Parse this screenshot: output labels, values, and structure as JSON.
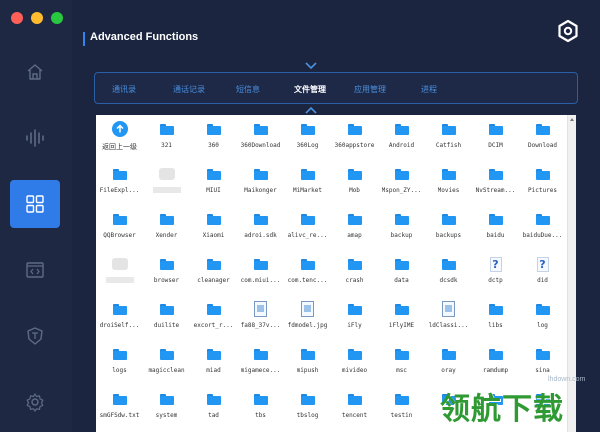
{
  "window": {
    "traffic_lights": [
      {
        "name": "close",
        "color": "#fe5f57"
      },
      {
        "name": "minimize",
        "color": "#febc2e"
      },
      {
        "name": "maximize",
        "color": "#28c840"
      }
    ]
  },
  "sidebar": {
    "items": [
      {
        "id": "home",
        "icon": "home-icon",
        "active": false
      },
      {
        "id": "audio",
        "icon": "audio-wave-icon",
        "active": false
      },
      {
        "id": "apps",
        "icon": "grid-icon",
        "active": true
      },
      {
        "id": "code",
        "icon": "code-window-icon",
        "active": false
      },
      {
        "id": "toolkit",
        "icon": "shield-t-icon",
        "active": false
      },
      {
        "id": "settings",
        "icon": "gear-icon",
        "active": false
      }
    ]
  },
  "header": {
    "title": "Advanced Functions"
  },
  "tabs": [
    {
      "label": "通讯录",
      "active": false
    },
    {
      "label": "通话记录",
      "active": false
    },
    {
      "label": "短信息",
      "active": false
    },
    {
      "label": "文件管理",
      "active": true
    },
    {
      "label": "应用管理",
      "active": false
    },
    {
      "label": "进程",
      "active": false
    }
  ],
  "files": [
    {
      "name": "返回上一级",
      "kind": "back"
    },
    {
      "name": "321",
      "kind": "folder"
    },
    {
      "name": "360",
      "kind": "folder"
    },
    {
      "name": "360Download",
      "kind": "folder"
    },
    {
      "name": "360Log",
      "kind": "folder"
    },
    {
      "name": "360appstore",
      "kind": "folder"
    },
    {
      "name": "Android",
      "kind": "folder"
    },
    {
      "name": "Catfish",
      "kind": "folder"
    },
    {
      "name": "DCIM",
      "kind": "folder"
    },
    {
      "name": "Download",
      "kind": "folder"
    },
    {
      "name": "FileExpl...",
      "kind": "folder"
    },
    {
      "name": "",
      "kind": "blurred"
    },
    {
      "name": "MIUI",
      "kind": "folder"
    },
    {
      "name": "Maikonger",
      "kind": "folder"
    },
    {
      "name": "MiMarket",
      "kind": "folder"
    },
    {
      "name": "Mob",
      "kind": "folder"
    },
    {
      "name": "Mspon_ZY...",
      "kind": "folder"
    },
    {
      "name": "Movies",
      "kind": "folder"
    },
    {
      "name": "NvStream...",
      "kind": "folder"
    },
    {
      "name": "Pictures",
      "kind": "folder"
    },
    {
      "name": "QQBrowser",
      "kind": "folder"
    },
    {
      "name": "Xender",
      "kind": "folder"
    },
    {
      "name": "Xiaomi",
      "kind": "folder"
    },
    {
      "name": "adroi.sdk",
      "kind": "folder"
    },
    {
      "name": "alivc_re...",
      "kind": "folder"
    },
    {
      "name": "amap",
      "kind": "folder"
    },
    {
      "name": "backup",
      "kind": "folder"
    },
    {
      "name": "backups",
      "kind": "folder"
    },
    {
      "name": "baidu",
      "kind": "folder"
    },
    {
      "name": "baiduDue...",
      "kind": "folder"
    },
    {
      "name": "",
      "kind": "blurred"
    },
    {
      "name": "browser",
      "kind": "folder"
    },
    {
      "name": "cleanager",
      "kind": "folder"
    },
    {
      "name": "com.miui...",
      "kind": "folder"
    },
    {
      "name": "com.tenc...",
      "kind": "folder"
    },
    {
      "name": "crash",
      "kind": "folder"
    },
    {
      "name": "data",
      "kind": "folder"
    },
    {
      "name": "dcsdk",
      "kind": "folder"
    },
    {
      "name": "dctp",
      "kind": "unknown"
    },
    {
      "name": "did",
      "kind": "unknown"
    },
    {
      "name": "droiSelf...",
      "kind": "folder"
    },
    {
      "name": "duilite",
      "kind": "folder"
    },
    {
      "name": "excort_r...",
      "kind": "folder"
    },
    {
      "name": "fa88_37v...",
      "kind": "image"
    },
    {
      "name": "fdmodel.jpg",
      "kind": "image"
    },
    {
      "name": "iFly",
      "kind": "folder"
    },
    {
      "name": "iFlyIME",
      "kind": "folder"
    },
    {
      "name": "ldClassi...",
      "kind": "image"
    },
    {
      "name": "libs",
      "kind": "folder"
    },
    {
      "name": "log",
      "kind": "folder"
    },
    {
      "name": "logs",
      "kind": "folder"
    },
    {
      "name": "magicclean",
      "kind": "folder"
    },
    {
      "name": "miad",
      "kind": "folder"
    },
    {
      "name": "migamece...",
      "kind": "folder"
    },
    {
      "name": "mipush",
      "kind": "folder"
    },
    {
      "name": "mivideo",
      "kind": "folder"
    },
    {
      "name": "msc",
      "kind": "folder"
    },
    {
      "name": "oray",
      "kind": "folder"
    },
    {
      "name": "ramdump",
      "kind": "folder"
    },
    {
      "name": "sina",
      "kind": "folder"
    },
    {
      "name": "smGFSdw.txt",
      "kind": "text"
    },
    {
      "name": "system",
      "kind": "folder"
    },
    {
      "name": "tad",
      "kind": "folder"
    },
    {
      "name": "tbs",
      "kind": "folder"
    },
    {
      "name": "tbslog",
      "kind": "folder"
    },
    {
      "name": "tencent",
      "kind": "folder"
    },
    {
      "name": "testin",
      "kind": "folder"
    },
    {
      "name": "",
      "kind": "folder"
    },
    {
      "name": "",
      "kind": "folder"
    },
    {
      "name": "",
      "kind": "folder"
    }
  ],
  "watermark": {
    "site": "lhdown.com",
    "text": "领航下载"
  },
  "colors": {
    "background": "#1b2540",
    "accent": "#2f7be8",
    "tab_inactive": "#4c90df",
    "folder": "#2196f3"
  }
}
